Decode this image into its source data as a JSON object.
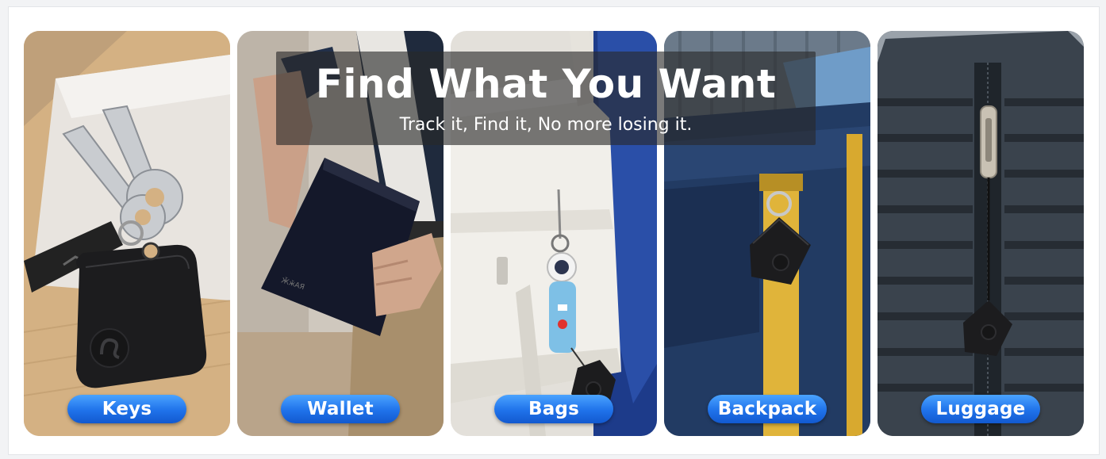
{
  "banner": {
    "headline": "Find What You Want",
    "subline": "Track it,  Find it, No more losing it."
  },
  "panels": [
    {
      "label": "Keys",
      "image": "keys-with-tracker-photo"
    },
    {
      "label": "Wallet",
      "image": "wallet-in-hand-photo"
    },
    {
      "label": "Bags",
      "image": "white-bag-with-tracker-photo"
    },
    {
      "label": "Backpack",
      "image": "blue-backpack-with-tracker-photo"
    },
    {
      "label": "Luggage",
      "image": "suitcase-zipper-with-tracker-photo"
    }
  ],
  "colors": {
    "pill_top": "#4aa3ff",
    "pill_bottom": "#1259cf",
    "tracker": "#1c1c1e",
    "backpack_strap": "#e0b43a",
    "backpack_fabric": "#1f3558"
  }
}
